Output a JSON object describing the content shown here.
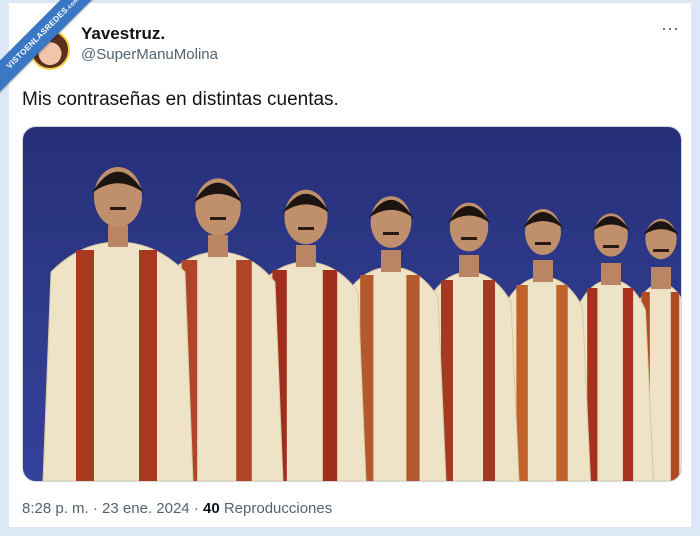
{
  "watermark": {
    "line1": "VISTOENLASREDES",
    "line2": ".com"
  },
  "author": {
    "name": "Yavestruz.",
    "handle": "@SuperManuMolina"
  },
  "menu": {
    "more_icon": "more-horizontal-icon",
    "label": "···"
  },
  "tweet": {
    "text": "Mis contraseñas en distintas cuentas."
  },
  "meta": {
    "time": "8:28 p. m.",
    "sep1": "·",
    "date": "23 ene. 2024",
    "sep2": "·",
    "views": "40",
    "views_label": "Reproducciones"
  },
  "colors": {
    "accent": "#1d9bf0",
    "text": "#0f1419",
    "muted": "#536471",
    "frame": "#dce8f5"
  }
}
